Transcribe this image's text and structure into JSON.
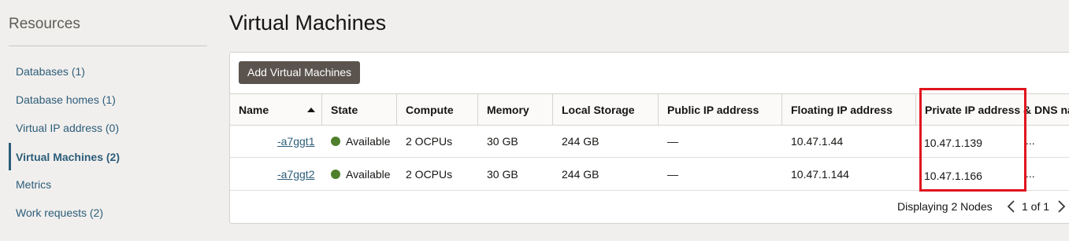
{
  "sidebar": {
    "title": "Resources",
    "items": [
      {
        "label": "Databases (1)"
      },
      {
        "label": "Database homes (1)"
      },
      {
        "label": "Virtual IP address (0)"
      },
      {
        "label": "Virtual Machines (2)",
        "active": true
      },
      {
        "label": "Metrics"
      },
      {
        "label": "Work requests (2)"
      }
    ]
  },
  "main": {
    "title": "Virtual Machines",
    "add_button": "Add Virtual Machines",
    "columns": [
      "Name",
      "State",
      "Compute",
      "Memory",
      "Local Storage",
      "Public IP address",
      "Floating IP address",
      "Private IP address & DNS na"
    ],
    "rows": [
      {
        "name": "-a7ggt1",
        "state": "Available",
        "compute": "2 OCPUs",
        "memory": "30 GB",
        "storage": "244 GB",
        "public_ip": "—",
        "floating_ip": "10.47.1.44",
        "private_ip": "10.47.1.139",
        "dns": "..."
      },
      {
        "name": "-a7ggt2",
        "state": "Available",
        "compute": "2 OCPUs",
        "memory": "30 GB",
        "storage": "244 GB",
        "public_ip": "—",
        "floating_ip": "10.47.1.144",
        "private_ip": "10.47.1.166",
        "dns": "..."
      }
    ],
    "footer": {
      "displaying": "Displaying 2 Nodes",
      "page": "1 of 1"
    }
  },
  "colors": {
    "accent": "#2c5d7a",
    "button": "#5b544e",
    "available": "#4e7f2c",
    "highlight": "#e0141e"
  }
}
